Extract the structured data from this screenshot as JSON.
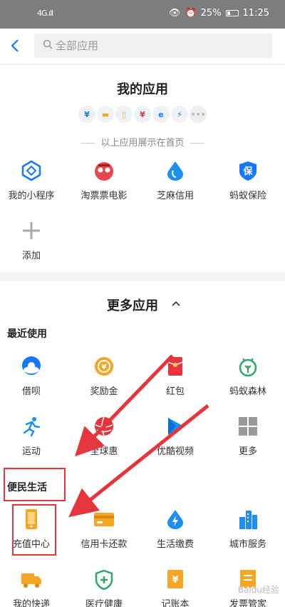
{
  "status_bar": {
    "signal": "4G.ıll",
    "battery": "25%",
    "time": "11:25"
  },
  "search": {
    "placeholder": "全部应用"
  },
  "my_apps": {
    "title": "我的应用",
    "hint": "以上应用展示在首页",
    "mini_icons": [
      "¥",
      "▬",
      "▯",
      "¥",
      "e",
      "⚡",
      "•••"
    ],
    "items": [
      {
        "label": "我的小程序",
        "icon": "mini-program-icon",
        "color": "#1677ff"
      },
      {
        "label": "淘票票电影",
        "icon": "movie-ticket-icon",
        "color": "#e5484d"
      },
      {
        "label": "芝麻信用",
        "icon": "sesame-credit-icon",
        "color": "#1d8ff0"
      },
      {
        "label": "蚂蚁保险",
        "icon": "ant-insurance-icon",
        "color": "#1677ff"
      },
      {
        "label": "添加",
        "icon": "add-icon",
        "color": "#999999"
      }
    ]
  },
  "more_apps": {
    "title": "更多应用",
    "recent_title": "最近使用",
    "recent": [
      {
        "label": "借呗",
        "icon": "jiebei-icon",
        "color": "#1677ff"
      },
      {
        "label": "奖励金",
        "icon": "reward-icon",
        "color": "#f5a623"
      },
      {
        "label": "红包",
        "icon": "red-packet-icon",
        "color": "#e5353d"
      },
      {
        "label": "蚂蚁森林",
        "icon": "ant-forest-icon",
        "color": "#2ea66a"
      },
      {
        "label": "运动",
        "icon": "sport-icon",
        "color": "#1d8ff0"
      },
      {
        "label": "全球惠",
        "icon": "global-deal-icon",
        "color": "#e5353d"
      },
      {
        "label": "优酷视频",
        "icon": "youku-icon",
        "color": "#1d8ff0"
      },
      {
        "label": "更多",
        "icon": "more-grid-icon",
        "color": "#999999"
      }
    ],
    "life_title": "便民生活",
    "life": [
      {
        "label": "充值中心",
        "icon": "phone-recharge-icon",
        "color": "#f5a623"
      },
      {
        "label": "信用卡还款",
        "icon": "credit-card-icon",
        "color": "#f5a623"
      },
      {
        "label": "生活缴费",
        "icon": "utility-icon",
        "color": "#1d8ff0"
      },
      {
        "label": "城市服务",
        "icon": "city-service-icon",
        "color": "#1d8ff0"
      },
      {
        "label": "我的快递",
        "icon": "express-icon",
        "color": "#f5a623"
      },
      {
        "label": "医疗健康",
        "icon": "medical-icon",
        "color": "#2ea66a"
      },
      {
        "label": "记账本",
        "icon": "ledger-icon",
        "color": "#f5a623"
      },
      {
        "label": "发票管家",
        "icon": "invoice-icon",
        "color": "#f5a623"
      }
    ]
  },
  "watermark": "Baidu经验",
  "annotation_color": "#e5353d"
}
